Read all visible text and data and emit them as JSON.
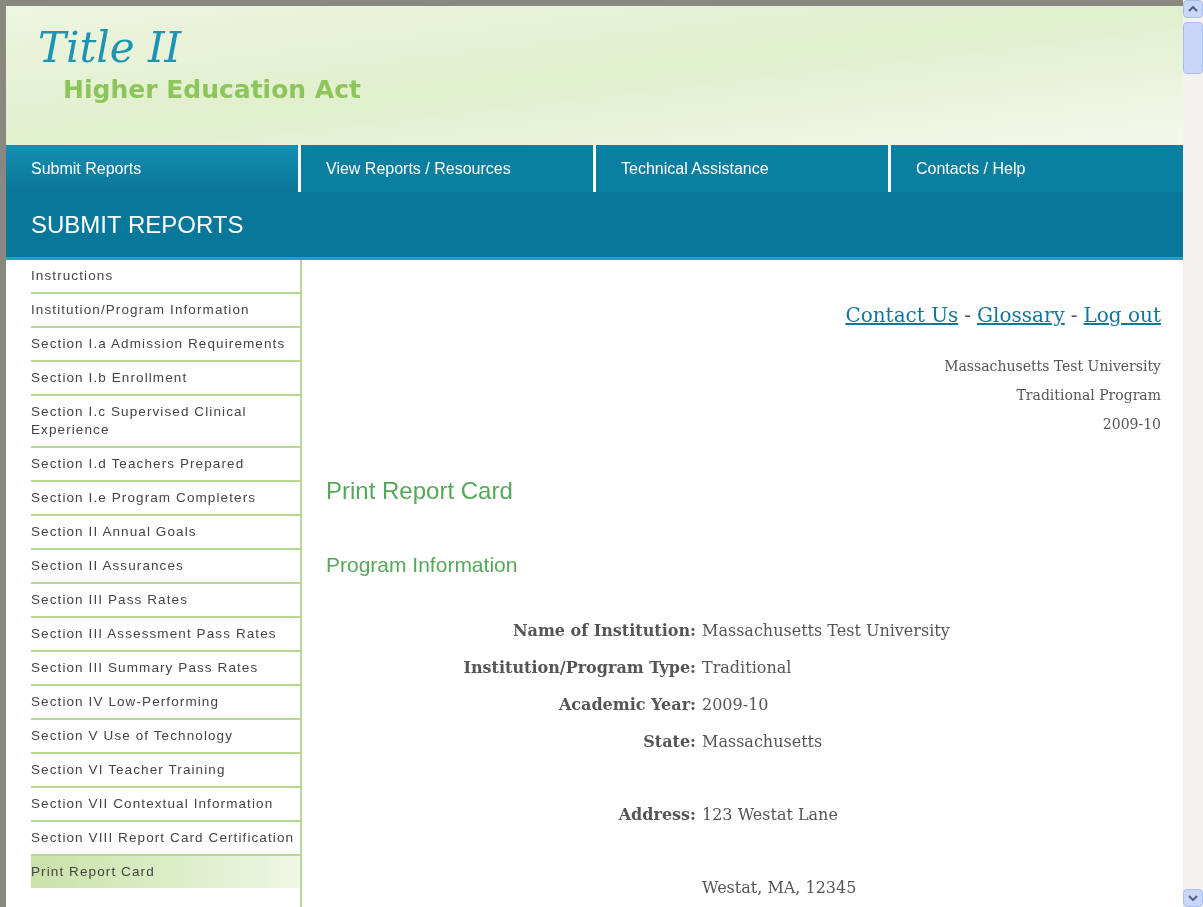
{
  "header": {
    "title": "Title II",
    "subtitle": "Higher Education Act"
  },
  "nav": [
    {
      "label": "Submit Reports",
      "selected": true
    },
    {
      "label": "View Reports / Resources",
      "selected": false
    },
    {
      "label": "Technical Assistance",
      "selected": false
    },
    {
      "label": "Contacts / Help",
      "selected": false
    }
  ],
  "section_title": "SUBMIT REPORTS",
  "sidebar": {
    "items": [
      {
        "label": "Instructions",
        "selected": false
      },
      {
        "label": "Institution/Program Information",
        "selected": false
      },
      {
        "label": "Section I.a Admission Requirements",
        "selected": false
      },
      {
        "label": "Section I.b Enrollment",
        "selected": false
      },
      {
        "label": "Section I.c Supervised Clinical Experience",
        "selected": false
      },
      {
        "label": "Section I.d Teachers Prepared",
        "selected": false
      },
      {
        "label": "Section I.e Program Completers",
        "selected": false
      },
      {
        "label": "Section II Annual Goals",
        "selected": false
      },
      {
        "label": "Section II Assurances",
        "selected": false
      },
      {
        "label": "Section III Pass Rates",
        "selected": false
      },
      {
        "label": "Section III Assessment Pass Rates",
        "selected": false
      },
      {
        "label": "Section III Summary Pass Rates",
        "selected": false
      },
      {
        "label": "Section IV Low-Performing",
        "selected": false
      },
      {
        "label": "Section V Use of Technology",
        "selected": false
      },
      {
        "label": "Section VI Teacher Training",
        "selected": false
      },
      {
        "label": "Section VII Contextual Information",
        "selected": false
      },
      {
        "label": "Section VIII Report Card Certification",
        "selected": false
      },
      {
        "label": "Print Report Card",
        "selected": true
      }
    ]
  },
  "links": [
    "Contact Us",
    "Glossary",
    "Log out"
  ],
  "link_separator": "-",
  "context": [
    "Massachusetts Test University",
    "Traditional Program",
    "2009-10"
  ],
  "page_title": "Print Report Card",
  "subheading": "Program Information",
  "fields": [
    {
      "label": "Name of Institution:",
      "value": "Massachusetts Test University"
    },
    {
      "label": "Institution/Program Type:",
      "value": "Traditional"
    },
    {
      "label": "Academic Year:",
      "value": "2009-10"
    },
    {
      "label": "State:",
      "value": "Massachusetts"
    }
  ],
  "address": {
    "label": "Address:",
    "lines": [
      "123 Westat Lane",
      "Westat, MA, 12345"
    ]
  }
}
